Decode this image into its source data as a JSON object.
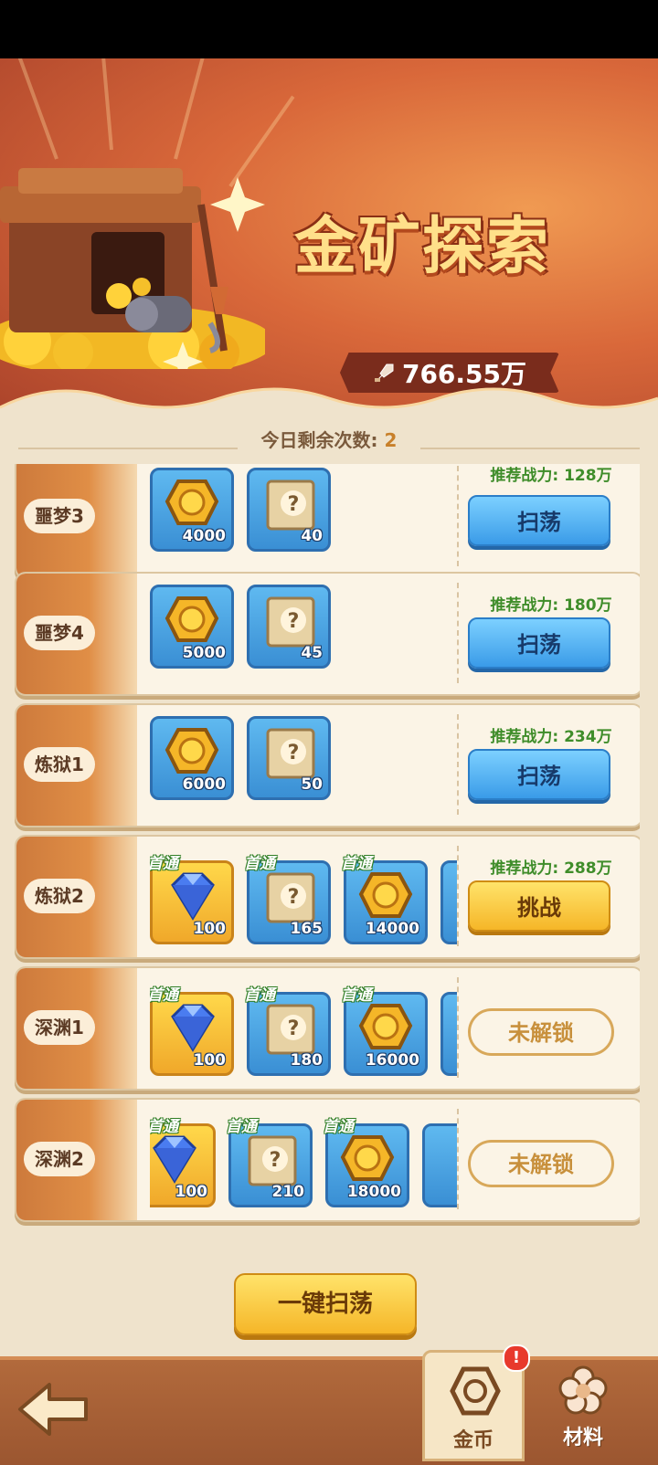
{
  "banner": {
    "title": "金矿探索",
    "power": "766.55万"
  },
  "remaining": {
    "label": "今日剩余次数: ",
    "count": "2"
  },
  "rows": [
    {
      "name": "噩梦3",
      "rewards": [
        {
          "type": "gold-coin",
          "qty": "4000",
          "first_clear": false
        },
        {
          "type": "mystery-scroll",
          "qty": "40",
          "first_clear": false
        }
      ],
      "recommended": "推荐战力: 128万",
      "action": "扫荡",
      "action_type": "sweep"
    },
    {
      "name": "噩梦4",
      "rewards": [
        {
          "type": "gold-coin",
          "qty": "5000",
          "first_clear": false
        },
        {
          "type": "mystery-scroll",
          "qty": "45",
          "first_clear": false
        }
      ],
      "recommended": "推荐战力: 180万",
      "action": "扫荡",
      "action_type": "sweep"
    },
    {
      "name": "炼狱1",
      "rewards": [
        {
          "type": "gold-coin",
          "qty": "6000",
          "first_clear": false
        },
        {
          "type": "mystery-scroll",
          "qty": "50",
          "first_clear": false
        }
      ],
      "recommended": "推荐战力: 234万",
      "action": "扫荡",
      "action_type": "sweep"
    },
    {
      "name": "炼狱2",
      "rewards": [
        {
          "type": "diamond",
          "qty": "100",
          "first_clear": true
        },
        {
          "type": "mystery-scroll",
          "qty": "165",
          "first_clear": true
        },
        {
          "type": "gold-coin",
          "qty": "14000",
          "first_clear": true
        }
      ],
      "recommended": "推荐战力: 288万",
      "action": "挑战",
      "action_type": "challenge"
    },
    {
      "name": "深渊1",
      "rewards": [
        {
          "type": "diamond",
          "qty": "100",
          "first_clear": true
        },
        {
          "type": "mystery-scroll",
          "qty": "180",
          "first_clear": true
        },
        {
          "type": "gold-coin",
          "qty": "16000",
          "first_clear": true
        }
      ],
      "recommended": "",
      "action": "未解锁",
      "action_type": "locked"
    },
    {
      "name": "深渊2",
      "rewards": [
        {
          "type": "diamond",
          "qty": "100",
          "first_clear": true
        },
        {
          "type": "mystery-scroll",
          "qty": "210",
          "first_clear": true
        },
        {
          "type": "gold-coin",
          "qty": "18000",
          "first_clear": true
        }
      ],
      "recommended": "",
      "action": "未解锁",
      "action_type": "locked"
    }
  ],
  "first_clear_label": "首通",
  "one_key_sweep": "一键扫荡",
  "tabs": {
    "gold": "金币",
    "materials": "材料",
    "badge": "!"
  },
  "colors": {
    "sweep_button": "#3a9be8",
    "challenge_button": "#f5b628",
    "recommended_text": "#3f8d2a"
  }
}
